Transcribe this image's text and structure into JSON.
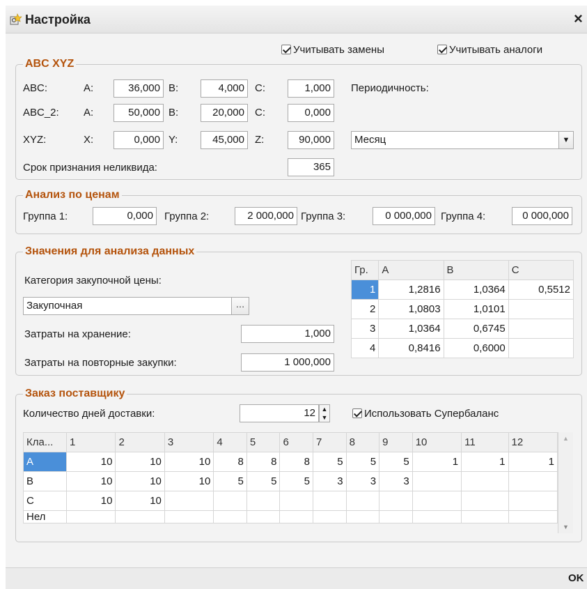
{
  "window": {
    "title": "Настройка",
    "close_label": "×",
    "ok_label": "OK"
  },
  "top_checks": {
    "replacements": "Учитывать замены",
    "analogs": "Учитывать аналоги"
  },
  "abcxyz": {
    "title": "ABC XYZ",
    "row_abc": {
      "label": "ABC:",
      "a_label": "A:",
      "a": "36,000",
      "b_label": "B:",
      "b": "4,000",
      "c_label": "C:",
      "c": "1,000"
    },
    "row_abc2": {
      "label": "ABC_2:",
      "a_label": "A:",
      "a": "50,000",
      "b_label": "B:",
      "b": "20,000",
      "c_label": "C:",
      "c": "0,000"
    },
    "row_xyz": {
      "label": "XYZ:",
      "x_label": "X:",
      "x": "0,000",
      "y_label": "Y:",
      "y": "45,000",
      "z_label": "Z:",
      "z": "90,000"
    },
    "periodicity_label": "Периодичность:",
    "periodicity_value": "Месяц",
    "illiquid_label": "Срок признания неликвида:",
    "illiquid_value": "365"
  },
  "price": {
    "title": "Анализ по ценам",
    "g1_label": "Группа 1:",
    "g1": "0,000",
    "g2_label": "Группа 2:",
    "g2": "2 000,000",
    "g3_label": "Группа 3:",
    "g3": "0 000,000",
    "g4_label": "Группа 4:",
    "g4": "0 000,000"
  },
  "values": {
    "title": "Значения для анализа данных",
    "category_label": "Категория закупочной цены:",
    "category_value": "Закупочная",
    "storage_label": "Затраты на хранение:",
    "storage_value": "1,000",
    "repeat_label": "Затраты на повторные закупки:",
    "repeat_value": "1 000,000",
    "table": {
      "headers": [
        "Гр.",
        "A",
        "B",
        "C"
      ],
      "rows": [
        [
          "1",
          "1,2816",
          "1,0364",
          "0,5512"
        ],
        [
          "2",
          "1,0803",
          "1,0101",
          ""
        ],
        [
          "3",
          "1,0364",
          "0,6745",
          ""
        ],
        [
          "4",
          "0,8416",
          "0,6000",
          ""
        ]
      ]
    }
  },
  "order": {
    "title": "Заказ поставщику",
    "days_label": "Количество дней доставки:",
    "days_value": "12",
    "superbalance": "Использовать Супербаланс",
    "table": {
      "headers": [
        "Кла...",
        "1",
        "2",
        "3",
        "4",
        "5",
        "6",
        "7",
        "8",
        "9",
        "10",
        "11",
        "12"
      ],
      "rows": [
        [
          "A",
          "10",
          "10",
          "10",
          "8",
          "8",
          "8",
          "5",
          "5",
          "5",
          "1",
          "1",
          "1"
        ],
        [
          "B",
          "10",
          "10",
          "10",
          "5",
          "5",
          "5",
          "3",
          "3",
          "3",
          "",
          "",
          ""
        ],
        [
          "C",
          "10",
          "10",
          "",
          "",
          "",
          "",
          "",
          "",
          "",
          "",
          "",
          ""
        ],
        [
          "Нел",
          "",
          "",
          "",
          "",
          "",
          "",
          "",
          "",
          "",
          "",
          "",
          ""
        ]
      ]
    }
  }
}
